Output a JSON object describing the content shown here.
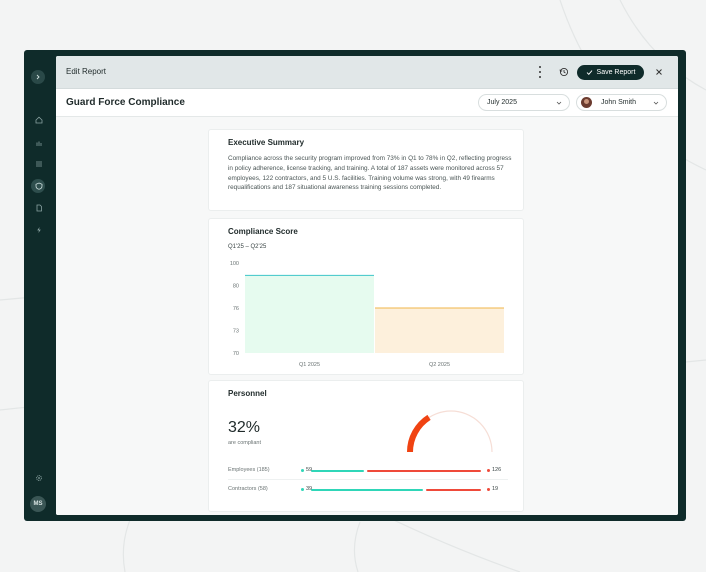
{
  "window": {
    "title": "Edit Report",
    "save_label": "Save Report"
  },
  "rail": {
    "user_initials": "MS"
  },
  "report": {
    "title": "Guard Force Compliance",
    "month": "July 2025",
    "user": "John Smith"
  },
  "summary": {
    "heading": "Executive Summary",
    "body": "Compliance across the security program improved from 73% in Q1 to 78% in Q2, reflecting progress in policy adherence, license tracking, and training. A total of 187 assets were monitored across 57 employees, 122 contractors, and 5 U.S. facilities. Training volume was strong, with 49 firearms requalifications and 187 situational awareness training sessions completed."
  },
  "score": {
    "heading": "Compliance Score",
    "range": "Q1'25 – Q2'25"
  },
  "chart_data": {
    "type": "bar",
    "categories": [
      "Q1 2025",
      "Q2 2025"
    ],
    "values": [
      89,
      76
    ],
    "y_ticks": [
      100,
      80,
      76,
      73,
      70
    ],
    "colors": {
      "q1_fill": "#e6fbef",
      "q1_line": "#3ec6c9",
      "q2_fill": "#fdf0dc",
      "q2_line": "#f0b64a"
    },
    "grid": false
  },
  "personnel": {
    "heading": "Personnel",
    "percent": "32%",
    "percent_label": "are compliant",
    "gauge_fraction": 0.32,
    "rows": [
      {
        "label": "Employees (185)",
        "compliant": "59",
        "noncompliant": "126",
        "compliant_n": 59,
        "noncompliant_n": 126
      },
      {
        "label": "Contractors (58)",
        "compliant": "39",
        "noncompliant": "19",
        "compliant_n": 39,
        "noncompliant_n": 19
      }
    ],
    "colors": {
      "good": "#2fd6b8",
      "bad": "#ef4a3a",
      "gauge": "#f04312",
      "gauge_track": "#f6ded6"
    }
  }
}
